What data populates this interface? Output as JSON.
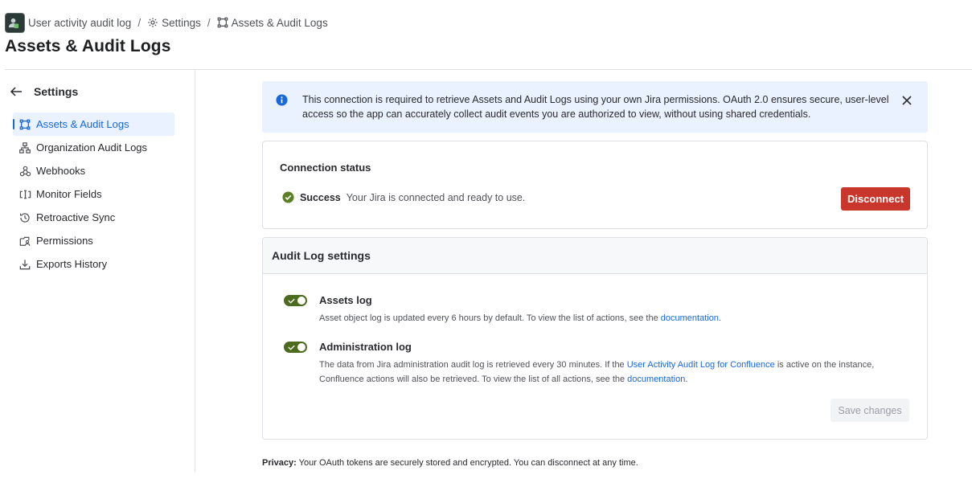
{
  "breadcrumbs": [
    {
      "label": "User activity audit log",
      "icon": "app-logo"
    },
    {
      "label": "Settings",
      "icon": "gear-icon"
    },
    {
      "label": "Assets & Audit Logs",
      "icon": "assets-icon"
    }
  ],
  "breadcrumb_separator": "/",
  "page_title": "Assets & Audit Logs",
  "sidebar": {
    "title": "Settings",
    "items": [
      {
        "label": "Assets & Audit Logs",
        "icon": "assets-icon",
        "active": true
      },
      {
        "label": "Organization Audit Logs",
        "icon": "hierarchy-icon",
        "active": false
      },
      {
        "label": "Webhooks",
        "icon": "webhook-icon",
        "active": false
      },
      {
        "label": "Monitor Fields",
        "icon": "fields-icon",
        "active": false
      },
      {
        "label": "Retroactive Sync",
        "icon": "history-icon",
        "active": false
      },
      {
        "label": "Permissions",
        "icon": "permissions-icon",
        "active": false
      },
      {
        "label": "Exports History",
        "icon": "download-icon",
        "active": false
      }
    ]
  },
  "banner": {
    "text": "This connection is required to retrieve Assets and Audit Logs using your own Jira permissions. OAuth 2.0 ensures secure, user-level access so the app can accurately collect audit events you are authorized to view, without using shared credentials."
  },
  "connection": {
    "label": "Connection status",
    "status": "Success",
    "message": "Your Jira is connected and ready to use.",
    "disconnect_label": "Disconnect"
  },
  "audit": {
    "title": "Audit Log settings",
    "assets": {
      "title": "Assets log",
      "enabled": true,
      "desc_before": "Asset object log is updated every 6 hours by default. To view the list of actions, see the ",
      "link": "documentation",
      "desc_after": "."
    },
    "admin": {
      "title": "Administration log",
      "enabled": true,
      "desc_before": "The data from Jira administration audit log is retrieved every 30 minutes. If the ",
      "link1": "User Activity Audit Log for Confluence",
      "desc_middle": " is active on the instance, Confluence actions will also be retrieved. To view the list of all actions, see the ",
      "link2": "documentation",
      "desc_after": "."
    },
    "save_label": "Save changes"
  },
  "privacy": {
    "label": "Privacy:",
    "text": " Your OAuth tokens are securely stored and encrypted. You can disconnect at any time."
  },
  "colors": {
    "accent": "#1868db",
    "danger": "#c9372c",
    "success": "#5b7f24",
    "toggle_on": "#4c6b1f",
    "banner_bg": "#e9f2fe"
  }
}
